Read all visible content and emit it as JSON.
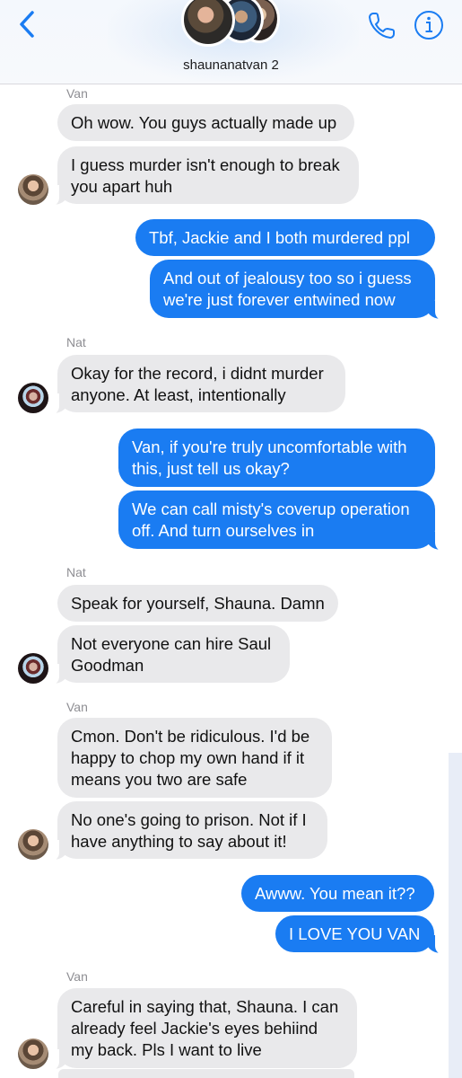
{
  "header": {
    "group_name": "shaunanatvan 2",
    "back_icon": "chevron-left-icon",
    "call_icon": "phone-icon",
    "info_icon": "info-icon",
    "accent": "#1a7cf2"
  },
  "thread": [
    {
      "sender": "Van"
    },
    {
      "text": "Oh wow. You guys actually made up"
    },
    {
      "text": "I guess murder isn't enough to break you apart huh"
    },
    {
      "text": "Tbf, Jackie and I both murdered ppl"
    },
    {
      "text": "And out of jealousy too so i guess we're just forever entwined now"
    },
    {
      "sender": "Nat"
    },
    {
      "text": "Okay for the record, i didnt murder anyone. At least, intentionally"
    },
    {
      "text": "Van, if you're truly uncomfortable with this, just tell us okay?"
    },
    {
      "text": "We can call misty's coverup operation off. And turn ourselves in"
    },
    {
      "sender": "Nat"
    },
    {
      "text": "Speak for yourself, Shauna. Damn"
    },
    {
      "text": "Not everyone can hire Saul Goodman"
    },
    {
      "sender": "Van"
    },
    {
      "text": "Cmon. Don't be ridiculous. I'd be happy to chop my own hand if it means you two are safe"
    },
    {
      "text": "No one's going to prison. Not if I have anything to say about it!"
    },
    {
      "text": "Awww. You mean it??"
    },
    {
      "text": "I LOVE YOU VAN"
    },
    {
      "sender": "Van"
    },
    {
      "text": "Careful in saying that, Shauna. I can already feel Jackie's eyes behiind my back. Pls I want to live"
    }
  ],
  "colors": {
    "incoming_bubble": "#e9e9eb",
    "outgoing_bubble": "#1a7cf2",
    "sender_label": "#8e8e93"
  }
}
